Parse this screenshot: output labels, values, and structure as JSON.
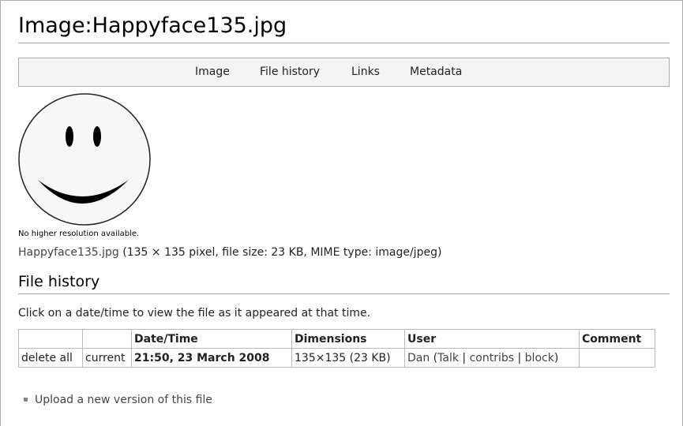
{
  "page": {
    "title": "Image:Happyface135.jpg"
  },
  "tabs": [
    {
      "label": "Image"
    },
    {
      "label": "File history"
    },
    {
      "label": "Links"
    },
    {
      "label": "Metadata"
    }
  ],
  "image": {
    "icon": "smiley-face-image",
    "no_higher_resolution": "No higher resolution available.",
    "file_name_link": "Happyface135.jpg",
    "file_details": " (135 × 135 pixel, file size: 23 KB, MIME type: image/jpeg)"
  },
  "file_history": {
    "heading": "File history",
    "instruction": "Click on a date/time to view the file as it appeared at that time.",
    "columns": [
      "",
      "",
      "Date/Time",
      "Dimensions",
      "User",
      "Comment"
    ],
    "rows": [
      {
        "action": "delete all",
        "status": "current",
        "datetime": "21:50, 23 March 2008",
        "dimensions": "135×135 (23 KB)",
        "user": "Dan",
        "user_links_open": " (",
        "talk": "Talk",
        "sep1": " | ",
        "contribs": "contribs",
        "sep2": " | ",
        "block": "block",
        "user_links_close": ")",
        "comment": ""
      }
    ]
  },
  "upload": {
    "label": "Upload a new version of this file"
  }
}
